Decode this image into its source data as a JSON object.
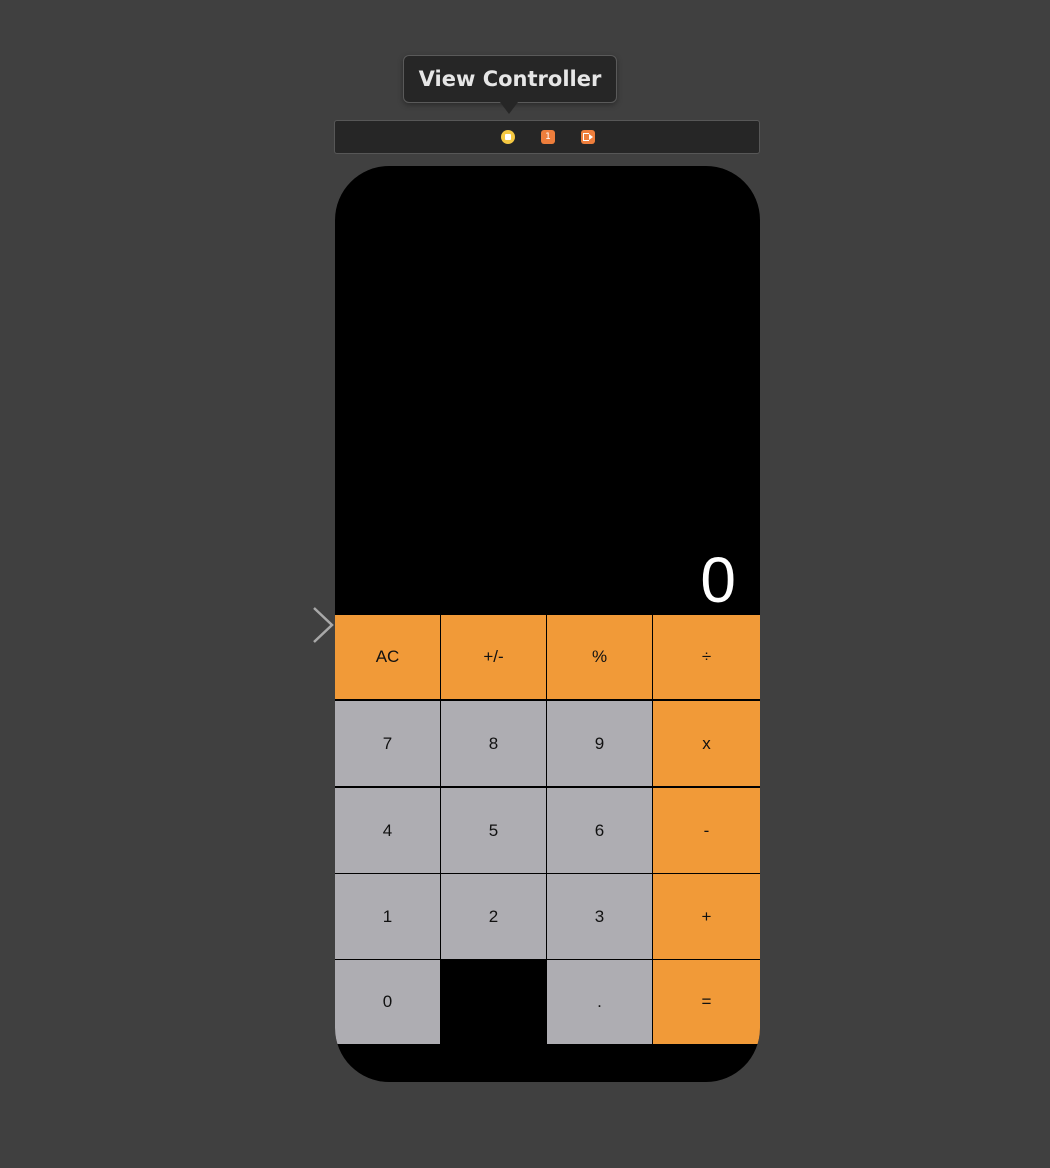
{
  "scene": {
    "title": "View Controller",
    "dock_icons": [
      {
        "name": "view-controller-icon",
        "color": "#f5c842"
      },
      {
        "name": "first-responder-icon",
        "glyph": "1",
        "color": "#ee7e3c"
      },
      {
        "name": "exit-icon",
        "color": "#ee7e3c"
      }
    ]
  },
  "calculator": {
    "display": "0",
    "colors": {
      "orange": "#f19a38",
      "gray": "#aeadb2",
      "background": "#000000",
      "canvas": "#404040"
    },
    "rows": [
      [
        {
          "label": "AC",
          "style": "orange"
        },
        {
          "label": "+/-",
          "style": "orange"
        },
        {
          "label": "%",
          "style": "orange"
        },
        {
          "label": "÷",
          "style": "orange"
        }
      ],
      [
        {
          "label": "7",
          "style": "gray"
        },
        {
          "label": "8",
          "style": "gray"
        },
        {
          "label": "9",
          "style": "gray"
        },
        {
          "label": "x",
          "style": "orange"
        }
      ],
      [
        {
          "label": "4",
          "style": "gray"
        },
        {
          "label": "5",
          "style": "gray"
        },
        {
          "label": "6",
          "style": "gray"
        },
        {
          "label": "-",
          "style": "orange"
        }
      ],
      [
        {
          "label": "1",
          "style": "gray"
        },
        {
          "label": "2",
          "style": "gray"
        },
        {
          "label": "3",
          "style": "gray"
        },
        {
          "label": "+",
          "style": "orange"
        }
      ],
      [
        {
          "label": "0",
          "style": "gray"
        },
        null,
        {
          "label": ".",
          "style": "gray"
        },
        {
          "label": "=",
          "style": "orange"
        }
      ]
    ]
  }
}
